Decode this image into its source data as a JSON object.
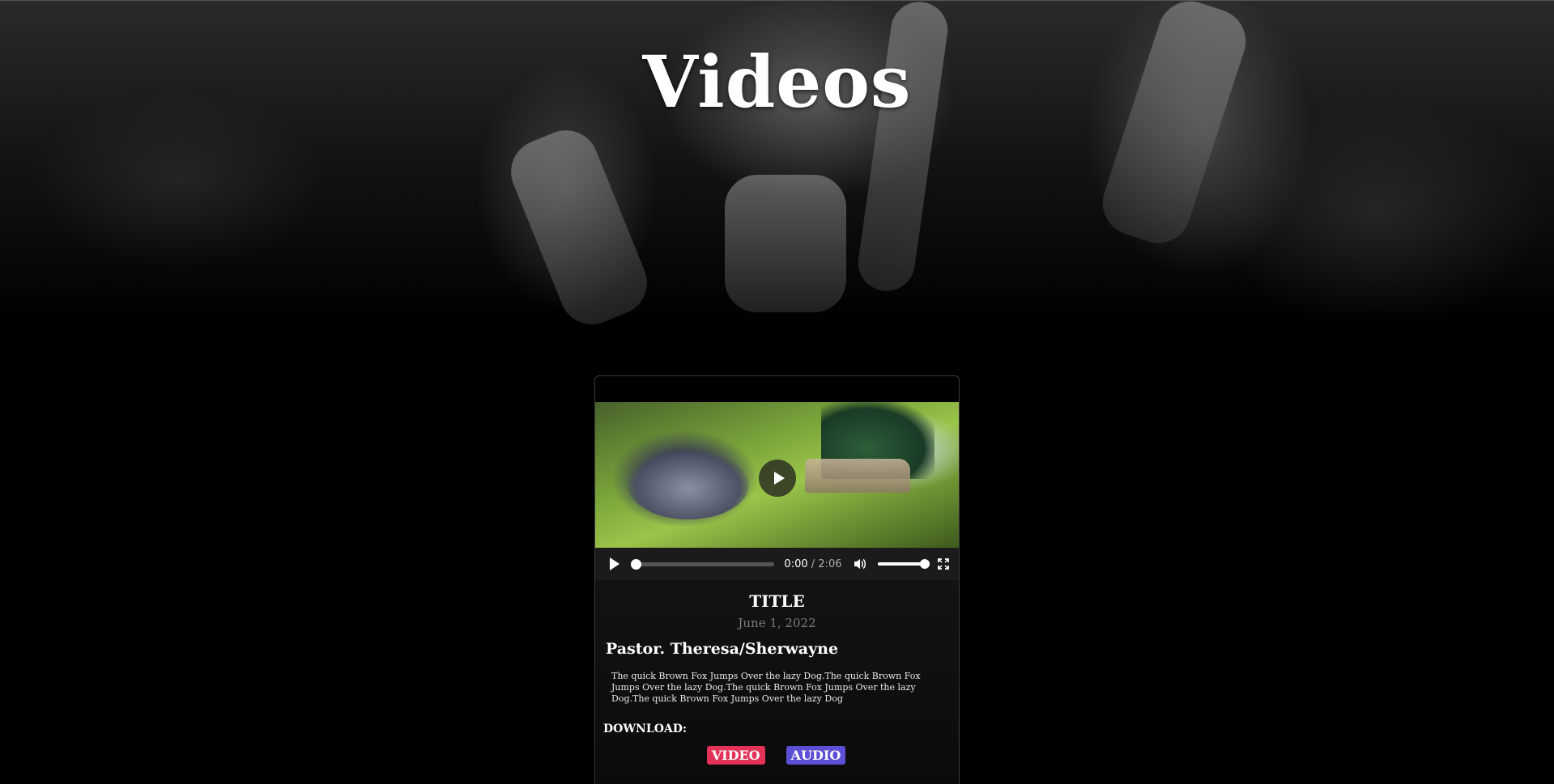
{
  "hero": {
    "title": "Videos"
  },
  "video": {
    "current_time": "0:00",
    "separator": "/",
    "duration": "2:06",
    "progress": 0.0,
    "volume": 1.0
  },
  "sermon": {
    "title": "TITLE",
    "date": "June 1, 2022",
    "speaker": "Pastor. Theresa/Sherwayne",
    "description": "The quick Brown Fox Jumps Over the lazy Dog.The quick Brown Fox Jumps Over the lazy Dog.The quick Brown Fox Jumps Over the lazy Dog.The quick Brown Fox Jumps Over the lazy Dog"
  },
  "download": {
    "label": "DOWNLOAD:",
    "video_label": "VIDEO",
    "audio_label": "AUDIO"
  },
  "colors": {
    "video_button": "#e33157",
    "audio_button": "#5b4fd6",
    "background": "#000000"
  },
  "icons": [
    "play-icon",
    "volume-icon",
    "fullscreen-icon"
  ]
}
